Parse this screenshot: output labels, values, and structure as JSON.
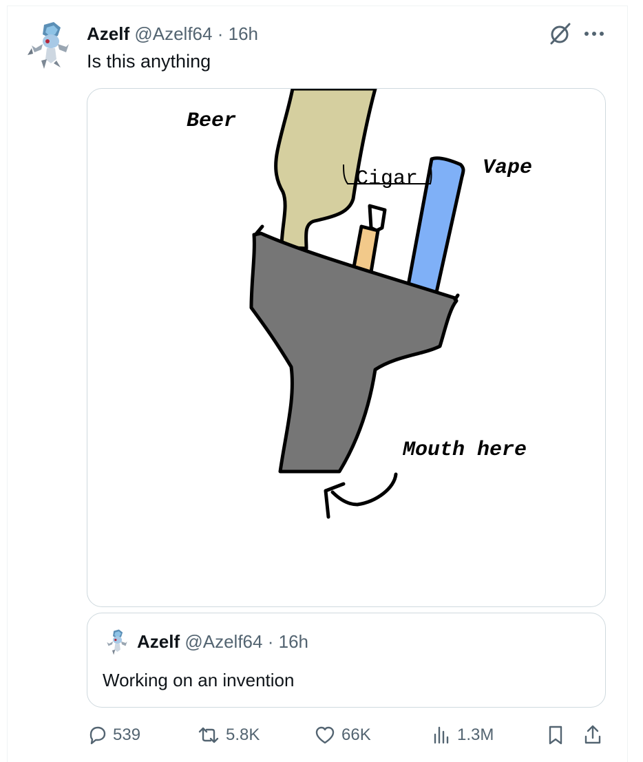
{
  "tweet": {
    "author_name": "Azelf",
    "author_handle": "@Azelf64",
    "separator": "·",
    "time": "16h",
    "text": "Is this anything",
    "avatar_icon": "azelf-pokemon-avatar",
    "media": {
      "labels": {
        "beer": "Beer",
        "cigar": "Cigar",
        "vape": "Vape",
        "mouth": "Mouth here"
      },
      "colors": {
        "beer_bottle": "#d5cf9f",
        "cigar_body": "#f2c98a",
        "vape_body": "#7fb0f7",
        "holder": "#767676",
        "outline": "#000000"
      }
    }
  },
  "quoted_tweet": {
    "author_name": "Azelf",
    "author_handle": "@Azelf64",
    "separator": "·",
    "time": "16h",
    "text": "Working on an invention"
  },
  "actions": {
    "replies": "539",
    "reposts": "5.8K",
    "likes": "66K",
    "views": "1.3M"
  },
  "colors": {
    "text_primary": "#0f1419",
    "text_secondary": "#536471",
    "border": "#cfd9de"
  }
}
